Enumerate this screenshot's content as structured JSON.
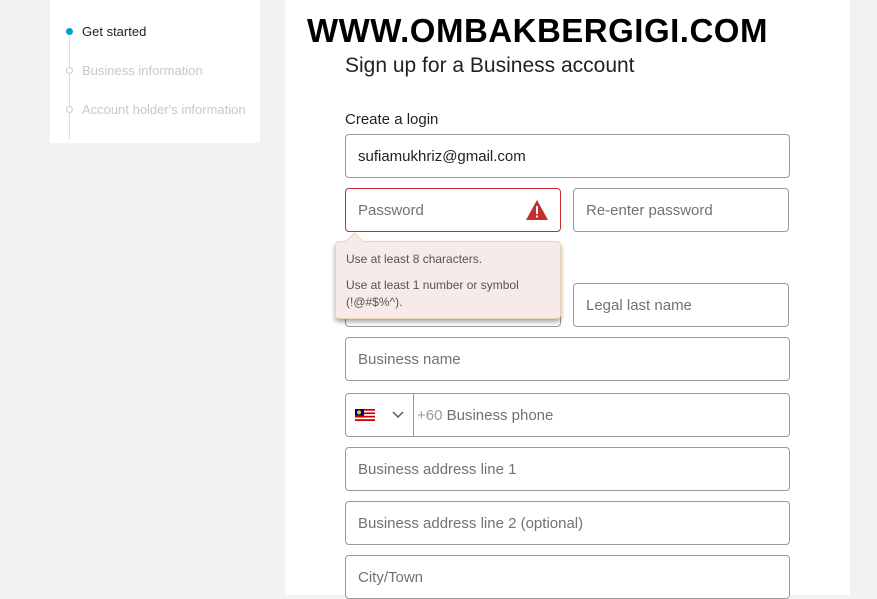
{
  "steps": [
    {
      "label": "Get started",
      "active": true
    },
    {
      "label": "Business information",
      "active": false
    },
    {
      "label": "Account holder's information",
      "active": false
    }
  ],
  "watermark": "WWW.OMBAKBERGIGI.COM",
  "title": "Sign up for a Business account",
  "login_label": "Create a login",
  "email_value": "sufiamukhriz@gmail.com",
  "password_placeholder": "Password",
  "reenter_placeholder": "Re-enter password",
  "tooltip": [
    "Use at least 8 characters.",
    "Use at least 1 number or symbol (!@#$%^)."
  ],
  "last_name_placeholder": "Legal last name",
  "business_name_placeholder": "Business name",
  "country_code": "+60",
  "phone_placeholder": "Business phone",
  "address1_placeholder": "Business address line 1",
  "address2_placeholder": "Business address line 2 (optional)",
  "city_placeholder": "City/Town",
  "colors": {
    "accent": "#009cde",
    "error": "#c72e2e"
  }
}
